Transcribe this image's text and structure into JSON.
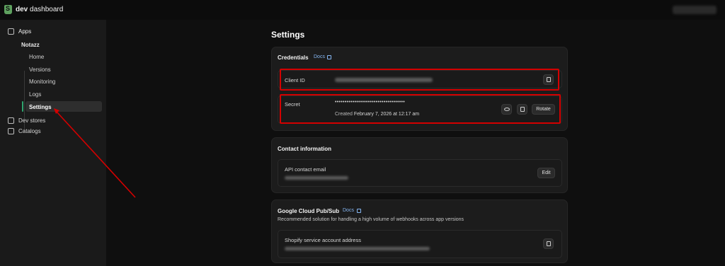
{
  "topbar": {
    "brand_bold": "dev",
    "brand_rest": "dashboard"
  },
  "sidebar": {
    "apps_label": "Apps",
    "app_name": "Notazz",
    "items": [
      {
        "label": "Home"
      },
      {
        "label": "Versions"
      },
      {
        "label": "Monitoring"
      },
      {
        "label": "Logs"
      },
      {
        "label": "Settings"
      }
    ],
    "dev_stores_label": "Dev stores",
    "catalogs_label": "Catalogs"
  },
  "main": {
    "title": "Settings",
    "credentials": {
      "title": "Credentials",
      "docs_label": "Docs",
      "client_id_label": "Client ID",
      "secret_label": "Secret",
      "secret_mask": "••••••••••••••••••••••••••••••••••••",
      "created_prefix": "Created",
      "created_value": "February 7, 2026 at 12:17 am",
      "rotate_label": "Rotate"
    },
    "contact": {
      "title": "Contact information",
      "email_label": "API contact email",
      "edit_label": "Edit"
    },
    "pubsub": {
      "title": "Google Cloud Pub/Sub",
      "docs_label": "Docs",
      "description": "Recommended solution for handling a high volume of webhooks across app versions",
      "account_label": "Shopify service account address"
    }
  },
  "colors": {
    "accent_active": "#2fa46e",
    "link": "#86b7f3",
    "highlight": "#d40000"
  }
}
